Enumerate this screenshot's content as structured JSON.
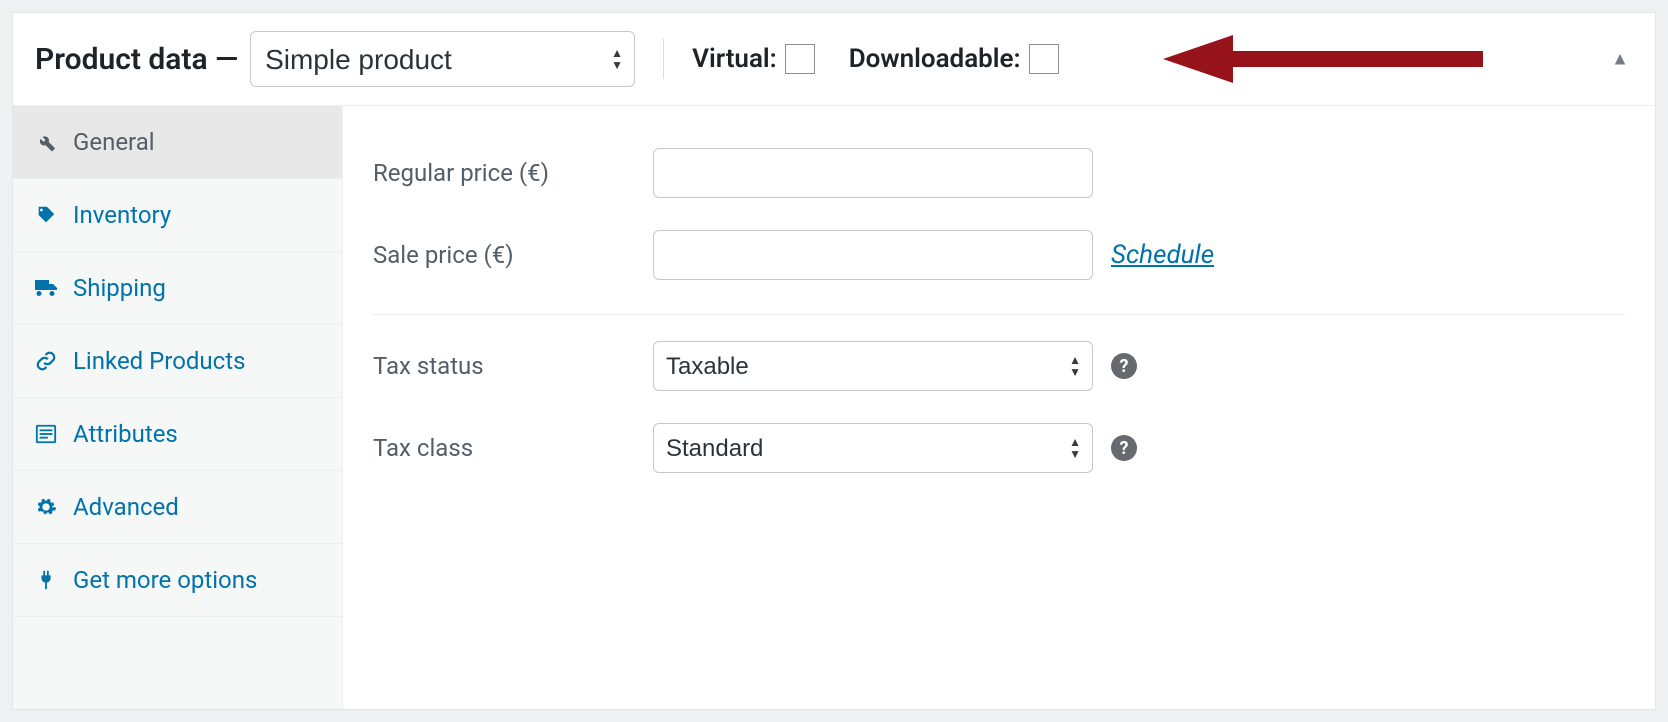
{
  "header": {
    "title": "Product data —",
    "product_type": "Simple product",
    "virtual_label": "Virtual:",
    "downloadable_label": "Downloadable:"
  },
  "tabs": [
    {
      "id": "general",
      "label": "General",
      "icon": "wrench-icon",
      "active": true
    },
    {
      "id": "inventory",
      "label": "Inventory",
      "icon": "tag-icon",
      "active": false
    },
    {
      "id": "shipping",
      "label": "Shipping",
      "icon": "truck-icon",
      "active": false
    },
    {
      "id": "linked",
      "label": "Linked Products",
      "icon": "link-icon",
      "active": false
    },
    {
      "id": "attrs",
      "label": "Attributes",
      "icon": "list-icon",
      "active": false
    },
    {
      "id": "advanced",
      "label": "Advanced",
      "icon": "gear-icon",
      "active": false
    },
    {
      "id": "more",
      "label": "Get more options",
      "icon": "plug-icon",
      "active": false
    }
  ],
  "form": {
    "regular_price_label": "Regular price (€)",
    "regular_price": "",
    "sale_price_label": "Sale price (€)",
    "sale_price": "",
    "schedule_label": "Schedule",
    "tax_status_label": "Tax status",
    "tax_status": "Taxable",
    "tax_class_label": "Tax class",
    "tax_class": "Standard"
  },
  "colors": {
    "link": "#0073aa",
    "arrow": "#96131a",
    "text_muted": "#555d66"
  }
}
